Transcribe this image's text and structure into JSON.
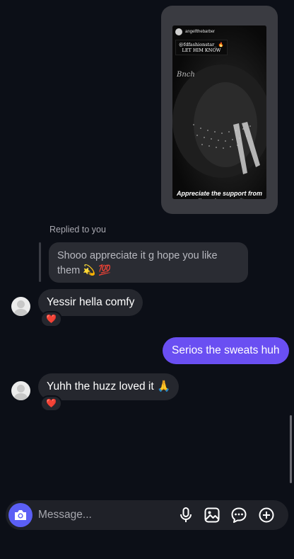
{
  "story": {
    "username": "angelfthebarber",
    "tag_text": "@fdfashionstar_ 🔥LET HIM KNOW",
    "caption": "Appreciate the support from all my buyers 🙌🏽"
  },
  "replied_label": "Replied to you",
  "reply_quote": "Shooo appreciate it g hope you like them 💫 💯",
  "messages": [
    {
      "text": "Yessir hella comfy",
      "reaction": "❤️"
    },
    {
      "text": "Serios the sweats huh"
    },
    {
      "text": "Yuhh the huzz loved it 🙏",
      "reaction": "❤️"
    }
  ],
  "composer": {
    "placeholder": "Message..."
  },
  "icons": [
    "camera-icon",
    "microphone-icon",
    "gallery-icon",
    "sticker-icon",
    "add-icon"
  ],
  "colors": {
    "accent": "#6a4ff2",
    "camera": "#5b5ff5",
    "background": "#0c0f17"
  }
}
